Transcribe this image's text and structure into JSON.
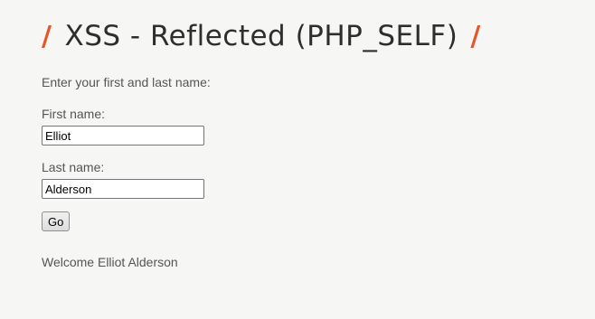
{
  "header": {
    "slash_left": "/",
    "title": "XSS - Reflected (PHP_SELF)",
    "slash_right": "/",
    "accent_color": "#e8542a"
  },
  "form": {
    "intro": "Enter your first and last name:",
    "first_name_label": "First name:",
    "first_name_value": "Elliot",
    "last_name_label": "Last name:",
    "last_name_value": "Alderson",
    "submit_label": "Go"
  },
  "result": {
    "welcome_text": "Welcome Elliot Alderson"
  }
}
